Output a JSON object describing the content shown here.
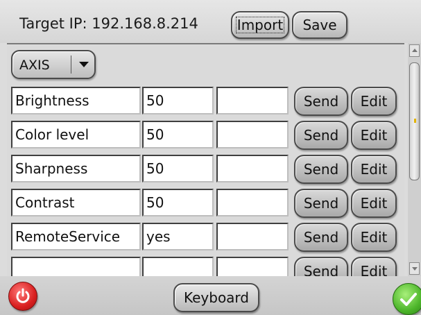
{
  "header": {
    "target_label": "Target IP: 192.168.8.214",
    "import_label": "Import",
    "save_label": "Save"
  },
  "device_select": {
    "value": "AXIS"
  },
  "rows": [
    {
      "name": "Brightness",
      "value": "50",
      "extra": "",
      "send": "Send",
      "edit": "Edit"
    },
    {
      "name": "Color level",
      "value": "50",
      "extra": "",
      "send": "Send",
      "edit": "Edit"
    },
    {
      "name": "Sharpness",
      "value": "50",
      "extra": "",
      "send": "Send",
      "edit": "Edit"
    },
    {
      "name": "Contrast",
      "value": "50",
      "extra": "",
      "send": "Send",
      "edit": "Edit"
    },
    {
      "name": "RemoteService",
      "value": "yes",
      "extra": "",
      "send": "Send",
      "edit": "Edit"
    },
    {
      "name": "",
      "value": "",
      "extra": "",
      "send": "Send",
      "edit": "Edit"
    }
  ],
  "footer": {
    "keyboard_label": "Keyboard",
    "power_icon": "power-icon",
    "ok_icon": "checkmark-icon"
  },
  "colors": {
    "power": "#d91f1f",
    "ok": "#4cb52a",
    "scroll_grip": "#e2b300"
  }
}
